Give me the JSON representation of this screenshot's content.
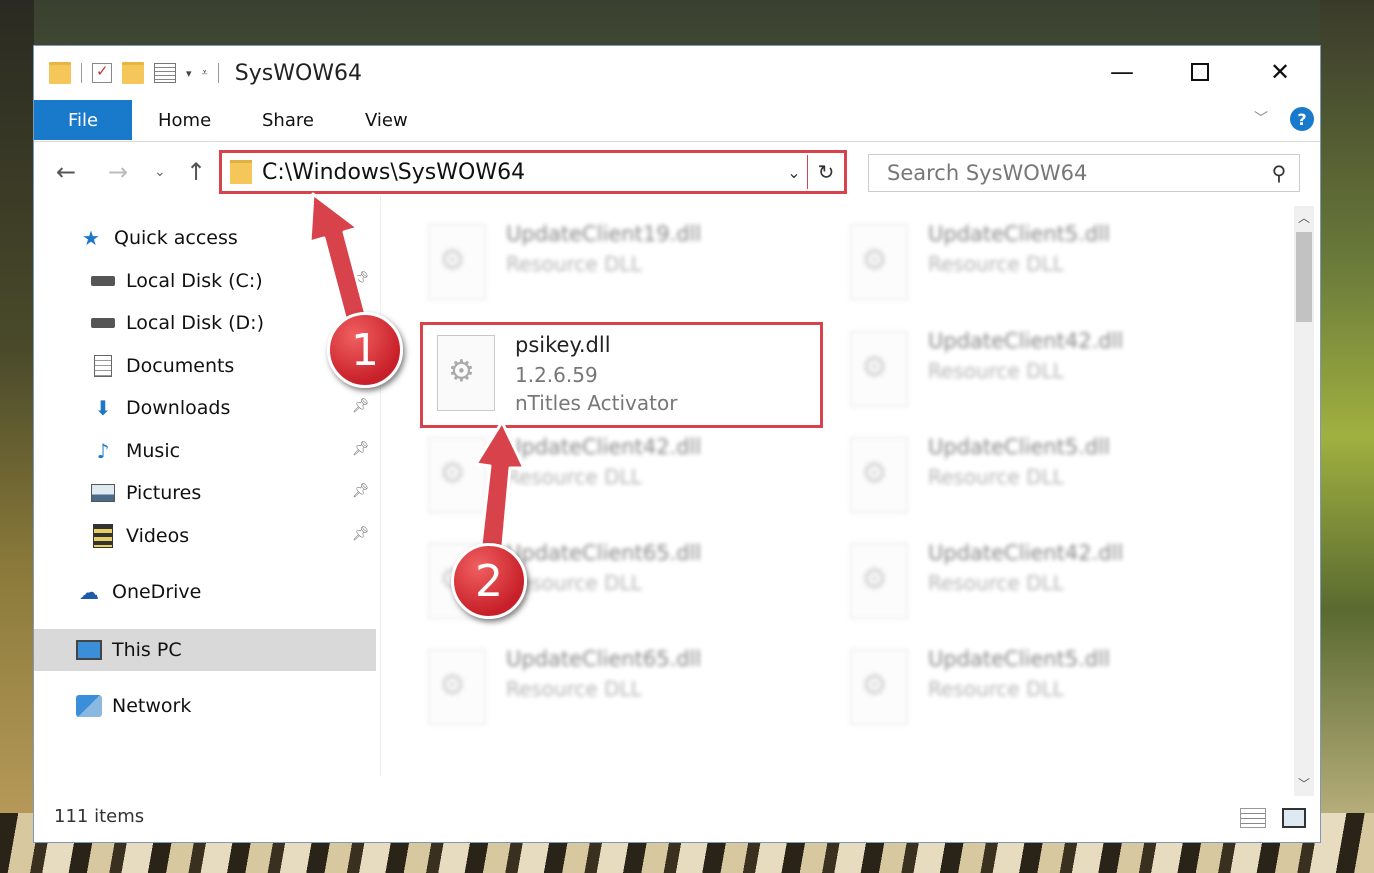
{
  "window": {
    "title": "SysWOW64",
    "min_glyph": "—",
    "close_glyph": "✕"
  },
  "ribbon": {
    "tabs": [
      "File",
      "Home",
      "Share",
      "View"
    ],
    "help": "?"
  },
  "nav": {
    "address": "C:\\Windows\\SysWOW64",
    "search_placeholder": "Search SysWOW64"
  },
  "sidebar": {
    "items": [
      {
        "label": "Quick access",
        "icon": "star-icon"
      },
      {
        "label": "Local Disk (C:)",
        "icon": "drive-icon",
        "pinned": true
      },
      {
        "label": "Local Disk (D:)",
        "icon": "drive-icon"
      },
      {
        "label": "Documents",
        "icon": "documents-icon"
      },
      {
        "label": "Downloads",
        "icon": "download-icon",
        "pinned": true
      },
      {
        "label": "Music",
        "icon": "music-icon",
        "pinned": true
      },
      {
        "label": "Pictures",
        "icon": "pictures-icon",
        "pinned": true
      },
      {
        "label": "Videos",
        "icon": "videos-icon",
        "pinned": true
      },
      {
        "label": "OneDrive",
        "icon": "cloud-icon"
      },
      {
        "label": "This PC",
        "icon": "computer-icon",
        "selected": true
      },
      {
        "label": "Network",
        "icon": "network-icon"
      }
    ]
  },
  "files": [
    {
      "name": "UpdateClient19.dll",
      "type": "Resource DLL",
      "blurred": true
    },
    {
      "name": "UpdateClient5.dll",
      "type": "Resource DLL",
      "blurred": true
    },
    {
      "name": "psikey.dll",
      "version": "1.2.6.59",
      "description": "nTitles Activator",
      "blurred": false,
      "highlighted": true
    },
    {
      "name": "UpdateClient42.dll",
      "type": "Resource DLL",
      "blurred": true
    },
    {
      "name": "UpdateClient42.dll",
      "type": "Resource DLL",
      "blurred": true
    },
    {
      "name": "UpdateClient5.dll",
      "type": "Resource DLL",
      "blurred": true
    },
    {
      "name": "UpdateClient65.dll",
      "type": "Resource DLL",
      "blurred": true
    },
    {
      "name": "UpdateClient42.dll",
      "type": "Resource DLL",
      "blurred": true
    },
    {
      "name": "UpdateClient65.dll",
      "type": "Resource DLL",
      "blurred": true
    },
    {
      "name": "UpdateClient5.dll",
      "type": "Resource DLL",
      "blurred": true
    }
  ],
  "status": {
    "item_count": "111 items"
  },
  "annotations": {
    "step1": "1",
    "step2": "2",
    "color": "#d8424a"
  }
}
